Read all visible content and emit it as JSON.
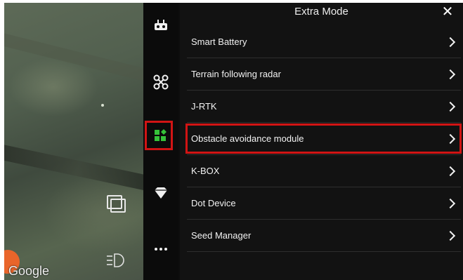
{
  "panel": {
    "title": "Extra Mode",
    "close_icon": "close-icon",
    "items": [
      {
        "label": "Smart Battery",
        "icon": "chevron-right-icon"
      },
      {
        "label": "Terrain following radar",
        "icon": "chevron-right-icon"
      },
      {
        "label": "J-RTK",
        "icon": "chevron-right-icon"
      },
      {
        "label": "Obstacle avoidance module",
        "icon": "chevron-right-icon",
        "highlighted": true
      },
      {
        "label": "K-BOX",
        "icon": "chevron-right-icon"
      },
      {
        "label": "Dot Device",
        "icon": "chevron-right-icon"
      },
      {
        "label": "Seed Manager",
        "icon": "chevron-right-icon"
      }
    ]
  },
  "nav_rail": {
    "items": [
      {
        "icon": "remote-controller-icon"
      },
      {
        "icon": "drone-icon"
      },
      {
        "icon": "extra-mode-icon",
        "active": true
      },
      {
        "icon": "diamond-icon"
      },
      {
        "icon": "more-icon"
      }
    ]
  },
  "map": {
    "attribution": "Google",
    "layers_icon": "layers-icon",
    "light_icon": "headlight-icon"
  },
  "colors": {
    "accent_green": "#35c23a",
    "highlight_red": "#d11414",
    "panel_bg": "#121212"
  }
}
